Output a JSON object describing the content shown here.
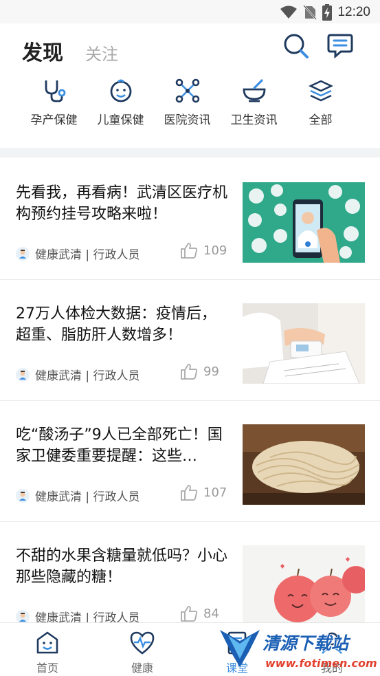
{
  "status_bar": {
    "time": "12:20"
  },
  "header": {
    "tab_active": "发现",
    "tab_inactive": "关注"
  },
  "categories": [
    {
      "label": "孕产保健",
      "icon": "stethoscope-icon"
    },
    {
      "label": "儿童保健",
      "icon": "baby-face-icon"
    },
    {
      "label": "医院资讯",
      "icon": "molecule-icon"
    },
    {
      "label": "卫生资讯",
      "icon": "mortar-icon"
    },
    {
      "label": "全部",
      "icon": "layers-icon"
    }
  ],
  "articles": [
    {
      "title": "先看我，再看病！武清区医疗机构预约挂号攻略来啦！",
      "author": "健康武清 | 行政人员",
      "likes": "109",
      "image": "phone-doctor-illustration"
    },
    {
      "title": "27万人体检大数据：疫情后，超重、脂肪肝人数增多！",
      "author": "健康武清 | 行政人员",
      "likes": "99",
      "image": "blood-pressure-photo"
    },
    {
      "title": "吃“酸汤子”9人已全部死亡！国家卫健委重要提醒：这些…",
      "author": "健康武清 | 行政人员",
      "likes": "107",
      "image": "noodles-photo"
    },
    {
      "title": "不甜的水果含糖量就低吗？小心那些隐藏的糖！",
      "author": "健康武清 | 行政人员",
      "likes": "84",
      "image": "apples-photo"
    }
  ],
  "bottom_nav": [
    {
      "label": "首页",
      "icon": "home-smile-icon",
      "active": false
    },
    {
      "label": "健康",
      "icon": "heart-pulse-icon",
      "active": false
    },
    {
      "label": "课堂",
      "icon": "classroom-icon",
      "active": true
    },
    {
      "label": "我的",
      "icon": "profile-icon",
      "active": false
    }
  ],
  "watermark": {
    "title": "清源下载站",
    "url": "www.fotimen.com"
  },
  "colors": {
    "accent": "#3b8ee0",
    "icon_dark": "#1f3a5f"
  }
}
